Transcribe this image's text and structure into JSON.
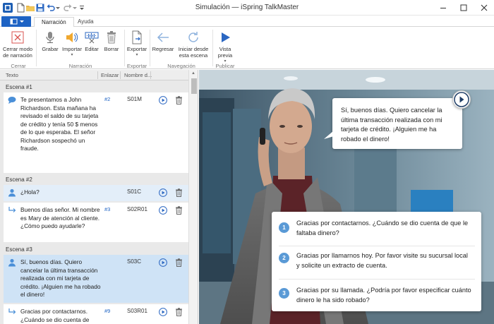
{
  "window": {
    "title": "Simulación — iSpring TalkMaster"
  },
  "tabs": [
    {
      "label": "Narración"
    },
    {
      "label": "Ayuda"
    }
  ],
  "ribbon": {
    "buttons": {
      "cerrar_modo": "Cerrar modo de narración",
      "grabar": "Grabar",
      "importar": "Importar",
      "editar": "Editar",
      "borrar": "Borrar",
      "exportar": "Exportar",
      "regresar": "Regresar",
      "iniciar": "Iniciar desde esta escena",
      "vista_previa": "Vista previa"
    },
    "groups": {
      "cerrar": "Cerrar",
      "narracion": "Narración",
      "exportar": "Exportar",
      "navegacion": "Navegación",
      "publicar": "Publicar"
    }
  },
  "columns": {
    "texto": "Texto",
    "enlazar": "Enlazar",
    "nombre": "Nombre d..."
  },
  "scenes": [
    {
      "label": "Escena #1"
    },
    {
      "label": "Escena #2"
    },
    {
      "label": "Escena #3"
    }
  ],
  "rows": [
    {
      "text": "Te presentamos a John Richardson. Esta mañana ha revisado el saldo de su tarjeta de crédito y tenía 50 $ menos de lo que esperaba. El señor Richardson sospechó un fraude.",
      "link": "#2",
      "name": "S01M"
    },
    {
      "text": "¿Hola?",
      "link": "",
      "name": "S01C"
    },
    {
      "text": "Buenos días señor. Mi nombre es Mary de atención al cliente. ¿Cómo puedo ayudarle?",
      "link": "#3",
      "name": "S02R01"
    },
    {
      "text": "Sí, buenos días. Quiero cancelar la última transacción realizada con mi tarjeta de crédito. ¡Alguien me ha robado el dinero!",
      "link": "",
      "name": "S03C"
    },
    {
      "text": "Gracias por contactarnos. ¿Cuándo se dio cuenta de",
      "link": "#9",
      "name": "S03R01"
    }
  ],
  "stage": {
    "bubble_text": "Sí, buenos días. Quiero cancelar la última transacción realizada con mi tarjeta de crédito. ¡Alguien me ha robado el dinero!",
    "options": [
      {
        "num": "1",
        "text": "Gracias por contactarnos. ¿Cuándo se dio cuenta de que le faltaba dinero?"
      },
      {
        "num": "2",
        "text": "Gracias por llamarnos hoy. Por favor visite su sucursal local y solicite un extracto de cuenta."
      },
      {
        "num": "3",
        "text": "Gracias por su llamada. ¿Podría por favor especificar cuánto dinero le ha sido robado?"
      }
    ]
  },
  "colors": {
    "accent": "#1e63c4",
    "selected_row": "#cfe3f6",
    "option_number": "#5a9ad6"
  }
}
